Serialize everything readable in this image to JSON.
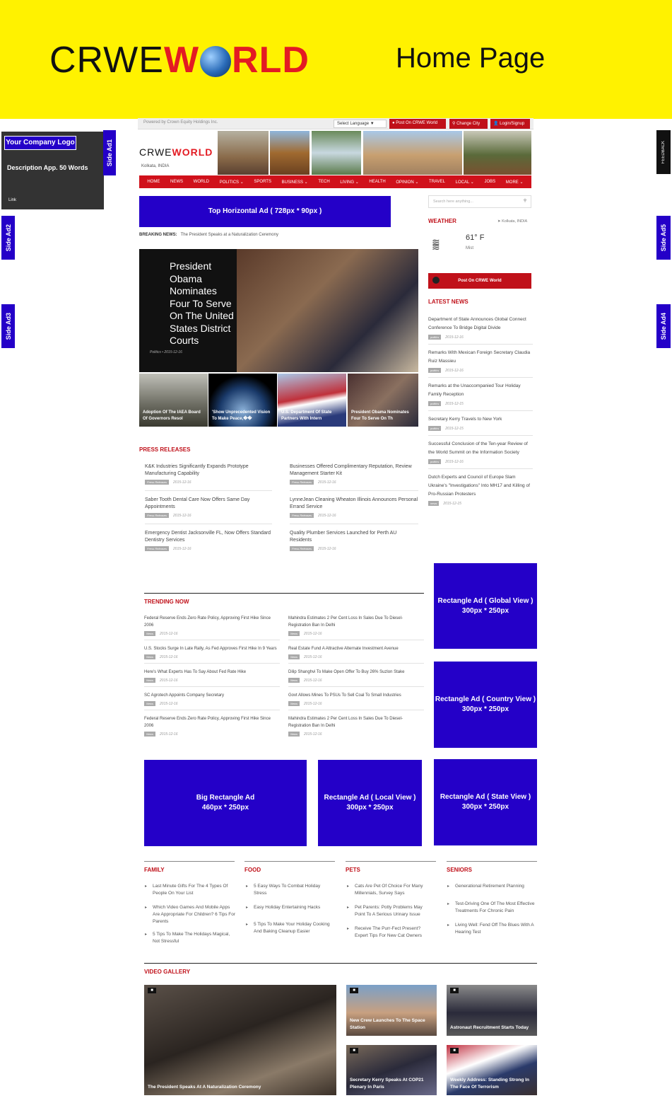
{
  "banner": {
    "brand_dark": "CRWE",
    "brand_w": "W",
    "brand_rld": "RLD",
    "page_title": "Home Page"
  },
  "topbar": {
    "powered": "Powered by Crown Equity Holdings Inc.",
    "language": "Select Language",
    "language_arrow": "▼",
    "post": "Post On CRWE World",
    "change_city": "Change City",
    "login": "Login/Signup"
  },
  "company": {
    "logo": "Your Company Logo",
    "description": "Description App. 50 Words",
    "link": "Link"
  },
  "side_ads": {
    "ad1": "Side Ad1",
    "ad2": "Side Ad2",
    "ad3": "Side Ad3",
    "ad4": "Side Ad4",
    "ad5": "Side Ad5",
    "feedback": "FEEDBACK"
  },
  "site": {
    "logo_dark": "CRWE",
    "logo_red": "WORLD",
    "location": "Kolkata, INDIA"
  },
  "nav": [
    "HOME",
    "NEWS",
    "WORLD",
    "POLITICS ⌄",
    "SPORTS",
    "BUSINESS ⌄",
    "TECH",
    "LIVING ⌄",
    "HEALTH",
    "OPINION ⌄",
    "TRAVEL",
    "LOCAL ⌄",
    "JOBS",
    "MORE ⌄"
  ],
  "top_ad": "Top Horizontal Ad ( 728px * 90px )",
  "breaking": {
    "label": "BREAKING NEWS:",
    "text": "The President Speaks at a Naturalization Ceremony"
  },
  "hero": {
    "title": "President Obama Nominates Four To Serve On The United States District Courts",
    "meta": "Politics  •  2015-12-16"
  },
  "thumbs": [
    "Adoption Of The IAEA Board Of Governors Resol",
    "'Show Unprecedented Vision To Make Peace,��",
    "U.S. Department Of State Partners With Intern",
    "President Obama Nominates Four To Serve On Th"
  ],
  "press": {
    "heading": "PRESS RELEASES",
    "tag": "Press Releases",
    "items": [
      {
        "title": "K&K Industries Significantly Expands Prototype Manufacturing Capability",
        "date": "2015-12-16"
      },
      {
        "title": "Businesses Offered Complimentary Reputation, Review Management Starter Kit",
        "date": "2015-12-16"
      },
      {
        "title": "Saber Tooth Dental Care Now Offers Same Day Appointments",
        "date": "2015-12-16"
      },
      {
        "title": "LynneJean Cleaning Wheaton Illinois Announces Personal Errand Service",
        "date": "2015-12-16"
      },
      {
        "title": "Emergency Dentist Jacksonville FL, Now Offers Standard Dentistry Services",
        "date": "2015-12-16"
      },
      {
        "title": "Quality Plumber Services Launched for Perth AU Residents",
        "date": "2015-12-16"
      }
    ]
  },
  "search": {
    "placeholder": "Search here anything..."
  },
  "weather": {
    "heading": "WEATHER",
    "location": "Kolkata, INDIA",
    "temp": "61° F",
    "condition": "Mist"
  },
  "post_button": "Post On CRWE World",
  "latest": {
    "heading": "LATEST NEWS",
    "items": [
      {
        "title": "Department of State Announces Global Connect Conference To Bridge Digital Divide",
        "tag": "politics",
        "date": "2015-12-16"
      },
      {
        "title": "Remarks With Mexican Foreign Secretary Claudia Ruiz Massieu",
        "tag": "politics",
        "date": "2015-12-16"
      },
      {
        "title": "Remarks at the Unaccompanied Tour Holiday Family Reception",
        "tag": "politics",
        "date": "2015-12-15"
      },
      {
        "title": "Secretary Kerry Travels to New York",
        "tag": "politics",
        "date": "2015-12-15"
      },
      {
        "title": "Successful Conclusion of the Ten-year Review of the World Summit on the Information Society",
        "tag": "politics",
        "date": "2015-12-16"
      },
      {
        "title": "Dutch Experts and Council of Europe Slam Ukraine's \"Investigations\" Into MH17 and Killing of Pro-Russian Protesters",
        "tag": "news",
        "date": "2015-12-15"
      }
    ]
  },
  "trending": {
    "heading": "TRENDING NOW",
    "tag": "News",
    "left": [
      {
        "title": "Federal Reserve Ends Zero Rate Policy, Approving First Hike Since 2006",
        "date": "2015-12-16"
      },
      {
        "title": "U.S. Stocks Surge In Late Rally, As Fed Approves First Hike In 9 Years",
        "date": "2015-12-16"
      },
      {
        "title": "Here's What Experts Has To Say About Fed Rate Hike",
        "date": "2015-12-16"
      },
      {
        "title": "SC Agrotech Appoints Company Secretary",
        "date": "2015-12-16"
      },
      {
        "title": "Federal Reserve Ends Zero Rate Policy, Approving First Hike Since 2006",
        "date": "2015-12-16"
      }
    ],
    "right": [
      {
        "title": "Mahindra Estimates 2 Per Cent Loss In Sales Due To Diesel-Registration Ban In Delhi",
        "date": "2015-12-16"
      },
      {
        "title": "Real Estate Fund A Attractive Alternate Investment Avenue",
        "date": "2015-12-16"
      },
      {
        "title": "Dilip Shanghvi To Make Open Offer To Buy 26% Suzlon Stake",
        "date": "2015-12-16"
      },
      {
        "title": "Govt Allows Mines To PSUs To Sell Coal To Small Industries",
        "date": "2015-12-16"
      },
      {
        "title": "Mahindra Estimates 2 Per Cent Loss In Sales Due To Diesel-Registration Ban In Delhi",
        "date": "2015-12-16"
      }
    ]
  },
  "ads": {
    "global_l1": "Rectangle Ad ( Global View )",
    "global_l2": "300px * 250px",
    "country_l1": "Rectangle Ad ( Country View )",
    "country_l2": "300px * 250px",
    "big_l1": "Big Rectangle Ad",
    "big_l2": "460px * 250px",
    "local_l1": "Rectangle Ad ( Local View )",
    "local_l2": "300px * 250px",
    "state_l1": "Rectangle Ad ( State View )",
    "state_l2": "300px * 250px"
  },
  "categories": [
    {
      "heading": "FAMILY",
      "items": [
        "Last Minute Gifts For The 4 Types Of People On Your List",
        "Which Video Games And Mobile Apps Are Appropriate For Children? 6 Tips For Parents",
        "5 Tips To Make The Holidays Magical, Not Stressful"
      ]
    },
    {
      "heading": "FOOD",
      "items": [
        "5 Easy Ways To Combat Holiday Stress",
        "Easy Holiday Entertaining Hacks",
        "5 Tips To Make Your Holiday Cooking And Baking Cleanup Easier"
      ]
    },
    {
      "heading": "PETS",
      "items": [
        "Cats Are Pet Of Choice For Many Millennials, Survey Says",
        "Pet Parents: Potty Problems May Point To A Serious Urinary Issue",
        "Receive The Purr-Fect Present? Expert Tips For New Cat Owners"
      ]
    },
    {
      "heading": "SENIORS",
      "items": [
        "Generational Retirement Planning",
        "Test-Driving One Of The Most Effective Treatments For Chronic Pain",
        "Living Well: Fend Off The Blues With A Hearing Test"
      ]
    }
  ],
  "video": {
    "heading": "VIDEO GALLERY",
    "main": "The President Speaks At A Naturalization Ceremony",
    "v1": "New Crew Launches To The Space Station",
    "v2": "Astronaut Recruitment Starts Today",
    "v3": "Secretary Kerry Speaks At COP21 Plenary In Paris",
    "v4": "Weekly Address: Standing Strong In The Face Of Terrorism"
  },
  "colors": {
    "accent_red": "#c0111a",
    "ad_blue": "#2400c8",
    "banner_yellow": "#fff200"
  }
}
